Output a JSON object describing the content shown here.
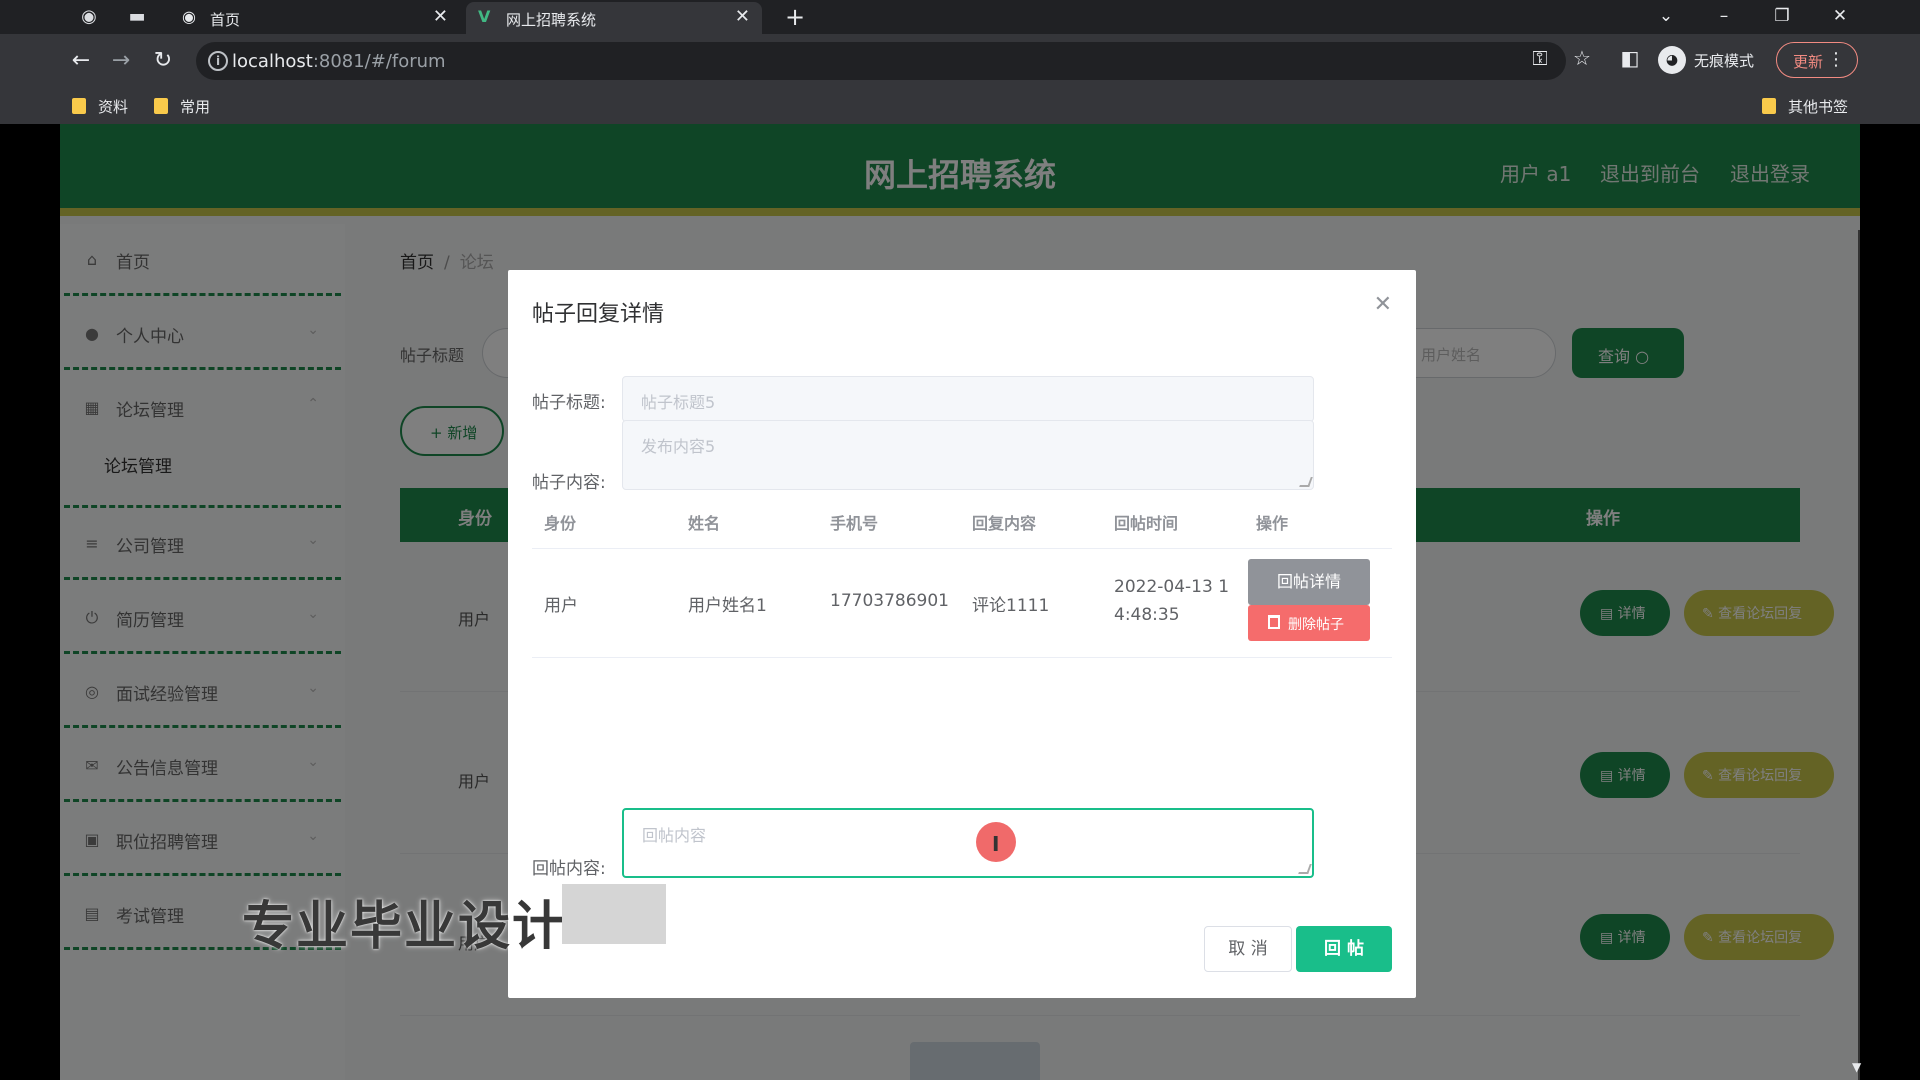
{
  "browser": {
    "tabs": [
      {
        "title": "首页",
        "icon": "globe-icon",
        "active": false
      },
      {
        "title": "网上招聘系统",
        "icon": "vue-logo-icon",
        "active": true
      }
    ],
    "url_host": "localhost",
    "url_rest": ":8081/#/forum",
    "incognito_label": "无痕模式",
    "update_label": "更新",
    "bookmarks": [
      "资料",
      "常用"
    ],
    "other_bookmarks": "其他书签"
  },
  "app": {
    "title": "网上招聘系统",
    "user_label": "用户 a1",
    "back_to_front": "退出到前台",
    "logout": "退出登录",
    "colors": {
      "primary": "#1e8a4c",
      "accent": "#c8c64b",
      "success": "#19be8a",
      "danger": "#f56c6c"
    }
  },
  "sidebar": {
    "items": [
      {
        "label": "首页",
        "icon": "home-icon"
      },
      {
        "label": "个人中心",
        "icon": "user-icon"
      },
      {
        "label": "论坛管理",
        "icon": "forum-icon"
      },
      {
        "label": "公司管理",
        "icon": "list-icon"
      },
      {
        "label": "简历管理",
        "icon": "power-icon"
      },
      {
        "label": "面试经验管理",
        "icon": "compass-icon"
      },
      {
        "label": "公告信息管理",
        "icon": "mail-icon"
      },
      {
        "label": "职位招聘管理",
        "icon": "briefcase-icon"
      },
      {
        "label": "考试管理",
        "icon": "exam-icon"
      }
    ],
    "sub_item": "论坛管理"
  },
  "main": {
    "breadcrumb_home": "首页",
    "breadcrumb_sep": "/",
    "breadcrumb_current": "论坛",
    "search_label": "帖子标题",
    "user_name_placeholder": "用户姓名",
    "query_button": "查询 ○",
    "add_button": "+ 新增",
    "table_headers": {
      "identity": "身份",
      "actions": "操作"
    },
    "rows": [
      {
        "identity": "用户",
        "detail": "▤ 详情",
        "view_replies": "✎ 查看论坛回复"
      },
      {
        "identity": "用户",
        "detail": "▤ 详情",
        "view_replies": "✎ 查看论坛回复"
      },
      {
        "identity": "用户",
        "detail": "▤ 详情",
        "view_replies": "✎ 查看论坛回复"
      }
    ]
  },
  "modal": {
    "title": "帖子回复详情",
    "post_title_label": "帖子标题:",
    "post_title_value": "帖子标题5",
    "post_content_label": "帖子内容:",
    "post_content_value": "发布内容5",
    "reply_table": {
      "headers": [
        "身份",
        "姓名",
        "手机号",
        "回复内容",
        "回帖时间",
        "操作"
      ],
      "rows": [
        {
          "identity": "用户",
          "name": "用户姓名1",
          "phone": "17703786901",
          "content": "评论1111",
          "time_line1": "2022-04-13 1",
          "time_line2": "4:48:35",
          "detail_btn": "回帖详情",
          "delete_btn": "删除帖子"
        }
      ]
    },
    "reply_label": "回帖内容:",
    "reply_placeholder": "回帖内容",
    "cancel": "取 消",
    "submit": "回 帖"
  },
  "watermark": "专业毕业设计"
}
